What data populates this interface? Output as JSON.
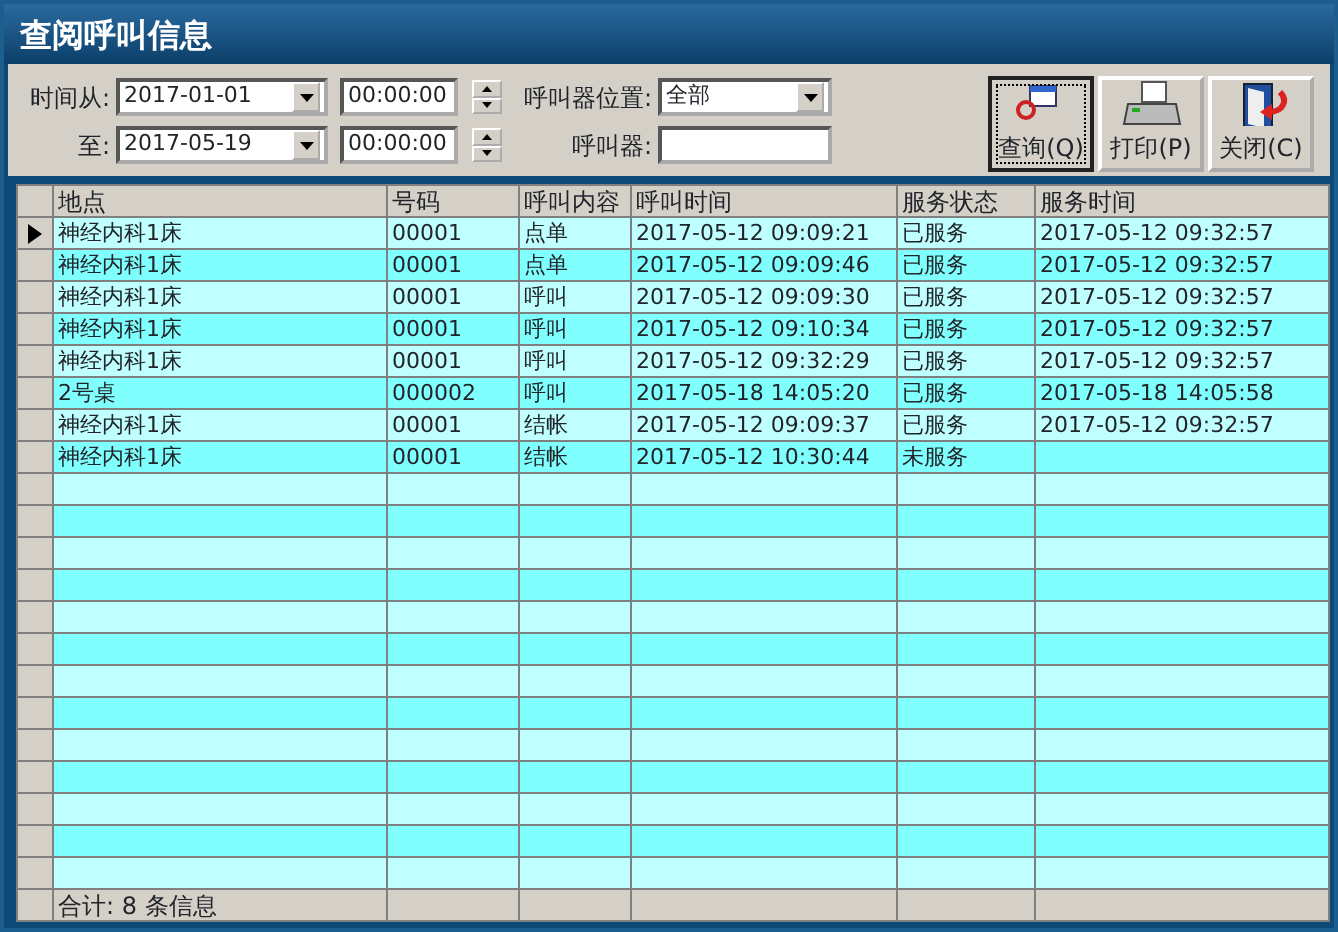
{
  "window": {
    "title": "查阅呼叫信息"
  },
  "filters": {
    "from_label": "时间从:",
    "from_date": "2017-01-01",
    "from_time": "00:00:00",
    "to_label": "至:",
    "to_date": "2017-05-19",
    "to_time": "00:00:00",
    "location_label": "呼叫器位置:",
    "location_value": "全部",
    "caller_label": "呼叫器:"
  },
  "buttons": [
    {
      "kind": "query",
      "label": "查询(Q)",
      "focused": true
    },
    {
      "kind": "print",
      "label": "打印(P)",
      "focused": false
    },
    {
      "kind": "close",
      "label": "关闭(C)",
      "focused": false
    }
  ],
  "table": {
    "columns": [
      "地点",
      "号码",
      "呼叫内容",
      "呼叫时间",
      "服务状态",
      "服务时间"
    ],
    "rows": [
      {
        "selected": true,
        "cells": [
          "神经内科1床",
          "00001",
          "点单",
          "2017-05-12 09:09:21",
          "已服务",
          "2017-05-12 09:32:57"
        ]
      },
      {
        "selected": false,
        "cells": [
          "神经内科1床",
          "00001",
          "点单",
          "2017-05-12 09:09:46",
          "已服务",
          "2017-05-12 09:32:57"
        ]
      },
      {
        "selected": false,
        "cells": [
          "神经内科1床",
          "00001",
          "呼叫",
          "2017-05-12 09:09:30",
          "已服务",
          "2017-05-12 09:32:57"
        ]
      },
      {
        "selected": false,
        "cells": [
          "神经内科1床",
          "00001",
          "呼叫",
          "2017-05-12 09:10:34",
          "已服务",
          "2017-05-12 09:32:57"
        ]
      },
      {
        "selected": false,
        "cells": [
          "神经内科1床",
          "00001",
          "呼叫",
          "2017-05-12 09:32:29",
          "已服务",
          "2017-05-12 09:32:57"
        ]
      },
      {
        "selected": false,
        "cells": [
          "2号桌",
          "000002",
          "呼叫",
          "2017-05-18 14:05:20",
          "已服务",
          "2017-05-18 14:05:58"
        ]
      },
      {
        "selected": false,
        "cells": [
          "神经内科1床",
          "00001",
          "结帐",
          "2017-05-12 09:09:37",
          "已服务",
          "2017-05-12 09:32:57"
        ]
      },
      {
        "selected": false,
        "cells": [
          "神经内科1床",
          "00001",
          "结帐",
          "2017-05-12 10:30:44",
          "未服务",
          ""
        ]
      }
    ],
    "footer": "合计: 8 条信息"
  }
}
